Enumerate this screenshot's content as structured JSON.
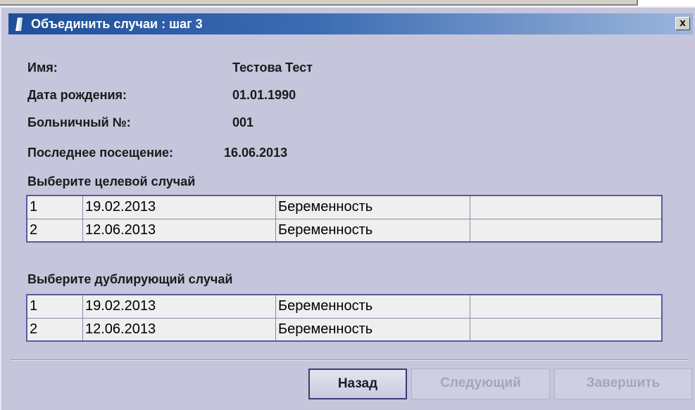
{
  "dialog": {
    "title": "Объединить случаи : шаг 3",
    "close_label": "x"
  },
  "patient": {
    "name_label": "Имя:",
    "name_value": "Тестова Тест",
    "dob_label": "Дата рождения:",
    "dob_value": "01.01.1990",
    "hospital_no_label": "Больничный №:",
    "hospital_no_value": "001",
    "last_visit_label": "Последнее посещение:",
    "last_visit_value": "16.06.2013"
  },
  "target_cases": {
    "label": "Выберите целевой случай",
    "rows": [
      {
        "num": "1",
        "date": "19.02.2013",
        "type": "Беременность",
        "extra": ""
      },
      {
        "num": "2",
        "date": "12.06.2013",
        "type": "Беременность",
        "extra": ""
      }
    ]
  },
  "duplicate_cases": {
    "label": "Выберите дублирующий случай",
    "rows": [
      {
        "num": "1",
        "date": "19.02.2013",
        "type": "Беременность",
        "extra": ""
      },
      {
        "num": "2",
        "date": "12.06.2013",
        "type": "Беременность",
        "extra": ""
      }
    ]
  },
  "buttons": {
    "back": "Назад",
    "next": "Следующий",
    "finish": "Завершить"
  },
  "colors": {
    "dialog_bg": "#c5c5dc",
    "title_bar_start": "#1f4f99",
    "grid_border": "#5a5aa0",
    "disabled_text": "#a4a4be"
  },
  "icons": {
    "title": "app-window-icon",
    "close": "close-icon"
  }
}
